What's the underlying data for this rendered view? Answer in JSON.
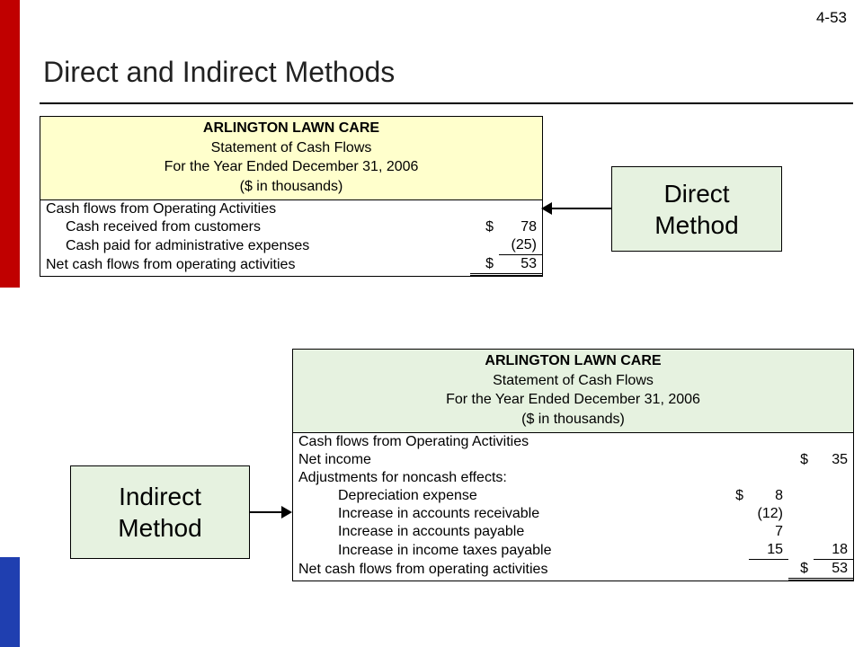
{
  "slide_number": "4-53",
  "title": "Direct and Indirect Methods",
  "direct_label_line1": "Direct",
  "direct_label_line2": "Method",
  "indirect_label_line1": "Indirect",
  "indirect_label_line2": "Method",
  "statement_header": {
    "company": "ARLINGTON LAWN CARE",
    "title": "Statement of Cash Flows",
    "period": "For the Year Ended December 31, 2006",
    "units": "($ in thousands)"
  },
  "direct": {
    "section": "Cash flows from Operating Activities",
    "row1_label": "Cash received from customers",
    "row1_sym": "$",
    "row1_val": "78",
    "row2_label": "Cash paid for administrative expenses",
    "row2_val": "(25)",
    "net_label": "Net cash flows from operating activities",
    "net_sym": "$",
    "net_val": "53"
  },
  "indirect": {
    "section": "Cash flows from Operating Activities",
    "netincome_label": "Net income",
    "netincome_sym": "$",
    "netincome_val": "35",
    "adjust_header": "Adjustments for noncash effects:",
    "r1_label": "Depreciation expense",
    "r1_sym": "$",
    "r1_val": "8",
    "r2_label": "Increase in accounts receivable",
    "r2_val": "(12)",
    "r3_label": "Increase in accounts payable",
    "r3_val": "7",
    "r4_label": "Increase in income taxes payable",
    "r4_val": "15",
    "adjust_total": "18",
    "net_label": "Net cash flows from operating activities",
    "net_sym": "$",
    "net_val": "53"
  }
}
